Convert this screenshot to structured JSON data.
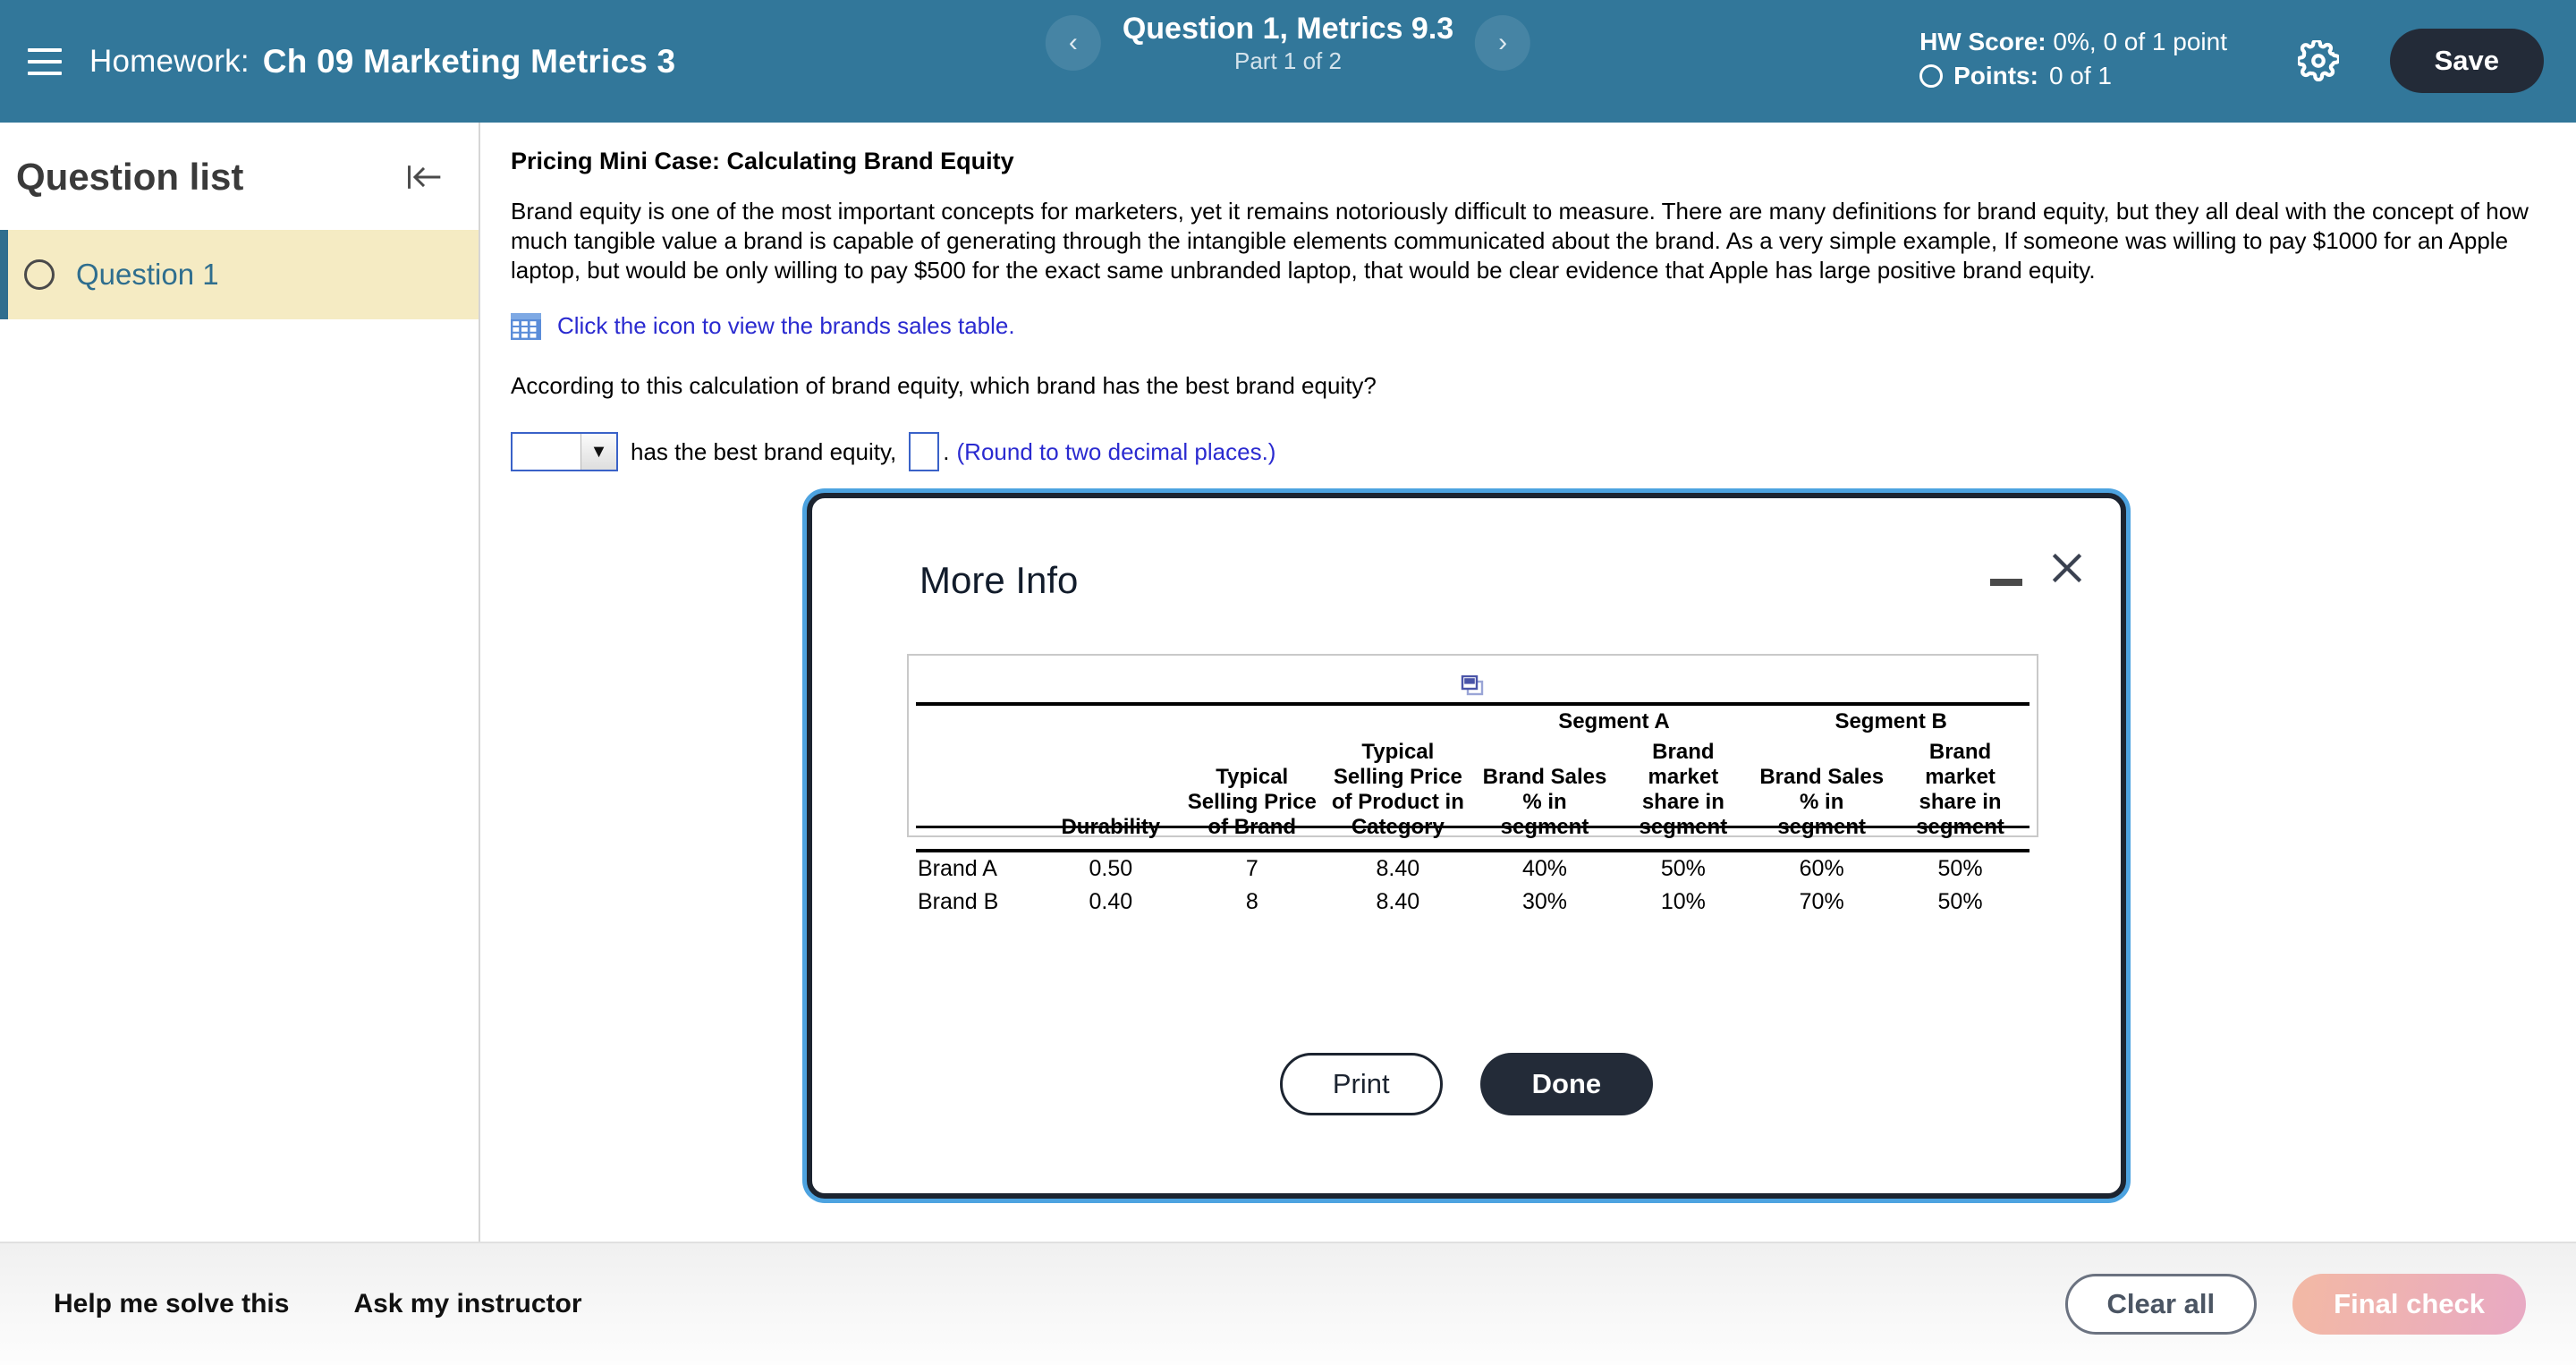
{
  "header": {
    "menu_icon": "hamburger-icon",
    "label": "Homework:",
    "title": "Ch 09 Marketing Metrics 3",
    "prev_icon": "‹",
    "next_icon": "›",
    "question_title": "Question 1, Metrics 9.3",
    "part_label": "Part 1 of 2",
    "hw_score_label": "HW Score:",
    "hw_score_value": " 0%, 0 of 1 point",
    "points_label": "Points:",
    "points_value": " 0 of 1",
    "gear_icon": "gear-icon",
    "save_label": "Save",
    "bg_color": "#32779a",
    "save_bg": "#232b38"
  },
  "sidebar": {
    "title": "Question list",
    "collapse_icon": "collapse-left-icon",
    "items": [
      {
        "label": "Question 1",
        "status_icon": "empty-circle-icon"
      }
    ],
    "active_bg": "#f5ebc3",
    "accent": "#2f6e8e"
  },
  "main": {
    "case_title": "Pricing Mini Case: Calculating Brand Equity",
    "paragraph": "Brand equity is one of the most important concepts for marketers, yet it remains notoriously difficult to measure.  There are many definitions for brand equity, but they all deal with the concept of how much tangible value a brand is capable of generating through the intangible elements communicated about the brand.  As a very simple example, If someone was willing to pay $1000 for an Apple laptop, but would be only willing to pay $500 for the exact same unbranded laptop, that would be clear evidence that Apple has large positive brand equity.",
    "table_link": "Click the icon to view the brands sales table.",
    "table_link_icon": "table-grid-icon",
    "question_prompt": "According to this calculation of brand equity, which brand has the best brand equity?",
    "answer_select_value": "",
    "answer_middle_text": "has the best brand equity,",
    "answer_blank_value": "",
    "answer_period": ".",
    "round_note": "(Round to two decimal places.)",
    "link_color": "#2a2ad0"
  },
  "modal": {
    "title": "More Info",
    "minimize_icon": "minimize-icon",
    "close_icon": "close-icon",
    "copy_icon": "copy-windows-icon",
    "print_label": "Print",
    "done_label": "Done",
    "border_color": "#1c2430",
    "focus_ring": "#4da3e0"
  },
  "chart_data": {
    "type": "table",
    "title": "Brand sales table",
    "group_headers": [
      {
        "label": "",
        "span": 4
      },
      {
        "label": "Segment A",
        "span": 2
      },
      {
        "label": "Segment B",
        "span": 2
      }
    ],
    "columns": [
      "",
      "Durability",
      "Typical Selling Price of Brand",
      "Typical Selling Price of Product in Category",
      "Brand Sales % in segment",
      "Brand market share in segment",
      "Brand Sales % in segment",
      "Brand market share in segment"
    ],
    "rows": [
      [
        "Brand A",
        "0.50",
        "7",
        "8.40",
        "40%",
        "50%",
        "60%",
        "50%"
      ],
      [
        "Brand B",
        "0.40",
        "8",
        "8.40",
        "30%",
        "10%",
        "70%",
        "50%"
      ]
    ]
  },
  "footer": {
    "help_label": "Help me solve this",
    "ask_label": "Ask my instructor",
    "clear_label": "Clear all",
    "final_label": "Final check",
    "final_bg": "#eeb0b8"
  }
}
